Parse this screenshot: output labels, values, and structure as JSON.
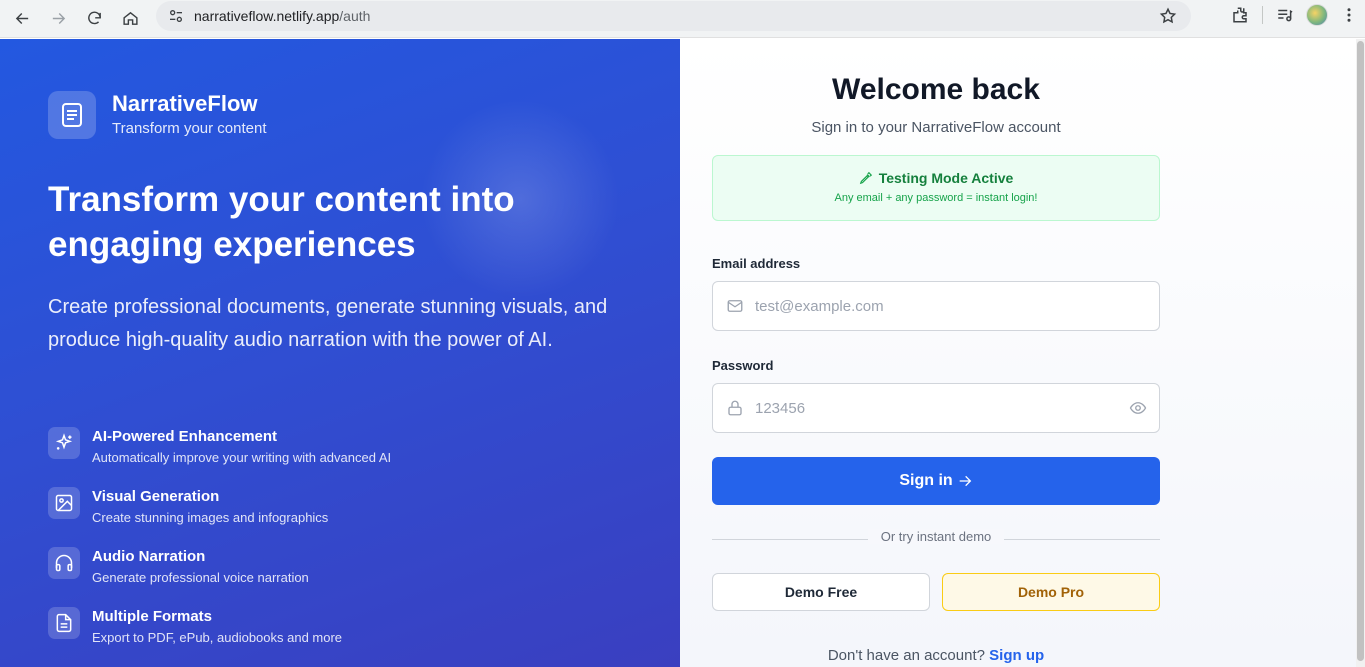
{
  "browser": {
    "url_host": "narrativeflow.netlify.app",
    "url_path": "/auth"
  },
  "brand": {
    "name": "NarrativeFlow",
    "tagline": "Transform your content"
  },
  "hero": {
    "title": "Transform your content into engaging experiences",
    "description": "Create professional documents, generate stunning visuals, and produce high-quality audio narration with the power of AI."
  },
  "features": [
    {
      "icon": "sparkles-icon",
      "title": "AI-Powered Enhancement",
      "desc": "Automatically improve your writing with advanced AI"
    },
    {
      "icon": "image-icon",
      "title": "Visual Generation",
      "desc": "Create stunning images and infographics"
    },
    {
      "icon": "headphones-icon",
      "title": "Audio Narration",
      "desc": "Generate professional voice narration"
    },
    {
      "icon": "document-icon",
      "title": "Multiple Formats",
      "desc": "Export to PDF, ePub, audiobooks and more"
    }
  ],
  "auth": {
    "title": "Welcome back",
    "subtitle": "Sign in to your NarrativeFlow account",
    "banner_title": "Testing Mode Active",
    "banner_desc": "Any email + any password = instant login!",
    "email_label": "Email address",
    "email_placeholder": "test@example.com",
    "password_label": "Password",
    "password_placeholder": "123456",
    "signin_label": "Sign in",
    "divider_text": "Or try instant demo",
    "demo_free_label": "Demo Free",
    "demo_pro_label": "Demo Pro",
    "signup_prompt": "Don't have an account?",
    "signup_link": "Sign up"
  },
  "colors": {
    "primary": "#2563eb",
    "hero_start": "#2358e0",
    "hero_end": "#3a3fc0",
    "success_bg": "#ecfdf3",
    "pro_accent": "#facc15"
  }
}
